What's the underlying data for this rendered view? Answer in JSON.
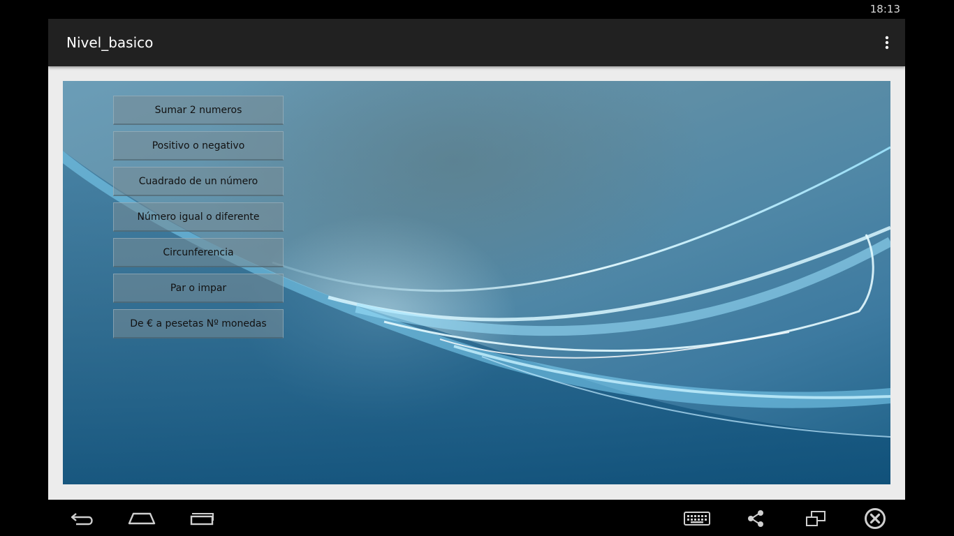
{
  "status_bar": {
    "time": "18:13"
  },
  "action_bar": {
    "title": "Nivel_basico",
    "overflow_icon": "more-vertical-icon"
  },
  "menu": {
    "items": [
      {
        "label": "Sumar 2 numeros"
      },
      {
        "label": "Positivo o negativo"
      },
      {
        "label": "Cuadrado de un número"
      },
      {
        "label": "Número igual o diferente"
      },
      {
        "label": "Circunferencia"
      },
      {
        "label": "Par o impar"
      },
      {
        "label": "De € a pesetas Nº monedas"
      }
    ]
  },
  "navigation_bar": {
    "icons": [
      "back-icon",
      "home-icon",
      "recent-apps-icon",
      "keyboard-icon",
      "share-icon",
      "window-icon",
      "close-circle-icon"
    ]
  },
  "colors": {
    "action_bar": "#212121",
    "window_background": "#ececec",
    "wallpaper_primary": "#4f87a6",
    "wallpaper_dark": "#1c5f86"
  }
}
